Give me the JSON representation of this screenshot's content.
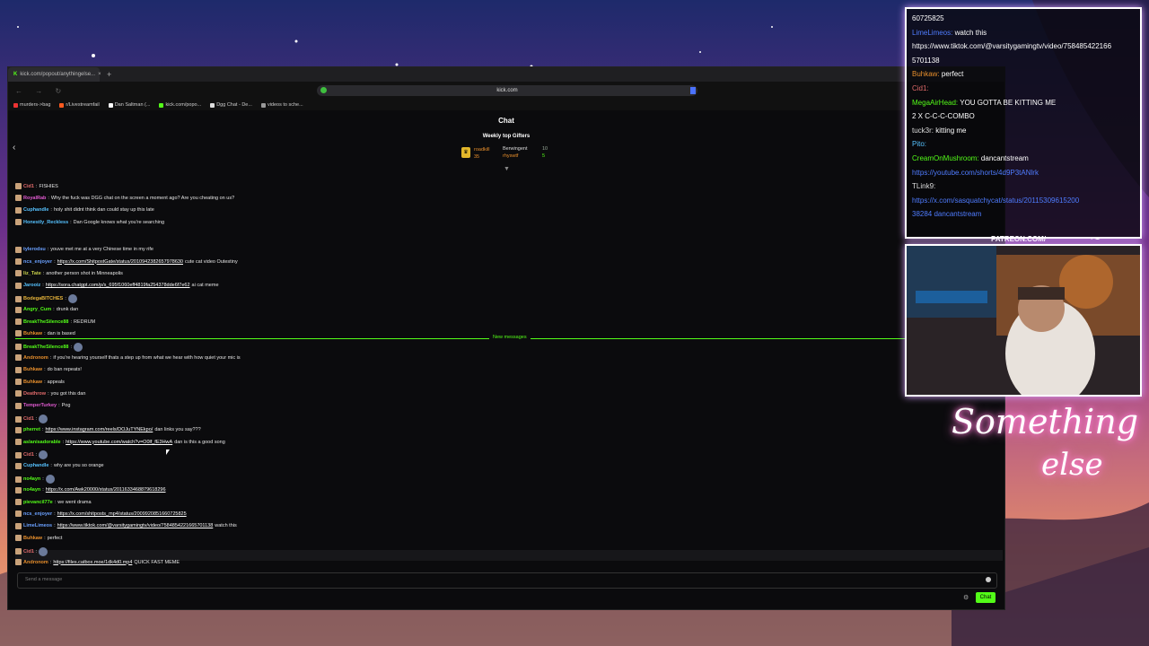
{
  "browser": {
    "tab_title": "kick.com/popout/anythingelse...",
    "tab_close": "×",
    "new_tab": "+",
    "url": "kick.com",
    "bookmarks": [
      "murders->bag",
      "r/Livestreamfail",
      "Dan Saltman (...",
      "kick.com/popo...",
      "Dgg Chat - De...",
      "videos to sche..."
    ]
  },
  "chat": {
    "title": "Chat",
    "back": "‹",
    "gifters_title": "Weekly top Gifters",
    "gifters": [
      {
        "name": "roadkill",
        "count": "35"
      },
      {
        "name": "Berwingent",
        "count": "10"
      },
      {
        "name": "rhyswtf",
        "count": "5"
      }
    ],
    "new_messages_label": "New messages",
    "input_placeholder": "Send a message",
    "send_label": "Chat",
    "messages": [
      {
        "user": "Cid1",
        "color": "#e06a6a",
        "text": "FISHIES",
        "link": ""
      },
      {
        "user": "RoyalRab",
        "color": "#e05ad0",
        "text": "Why the fuck was DGG chat on the screen a moment ago? Are you cheating on us?",
        "link": ""
      },
      {
        "user": "Cuphandle",
        "color": "#56c2ff",
        "text": "holy shit didnt think dan could stay up this late",
        "link": ""
      },
      {
        "user": "Honestly_Reckless",
        "color": "#56c2ff",
        "text": "Dan Google knows what you're searching",
        "link": ""
      },
      {
        "user": "tylerodsu",
        "color": "#6aa0ff",
        "text": "youve met me at a very Chinese time in my rife",
        "link": ""
      },
      {
        "user": "ncs_enjoyer",
        "color": "#6aa0ff",
        "text": "cute cat video Outestiny",
        "link": "https://x.com/ShitpostGate/status/2010942382657978630"
      },
      {
        "user": "liz_Tate",
        "color": "#c8d04a",
        "text": "another person shot in Minneapolis",
        "link": ""
      },
      {
        "user": "Jarooiz",
        "color": "#56c2ff",
        "text": "ai cat meme",
        "link": "https://sora.chatgpt.com/p/s_695f1060eff4819fa254378dde6f7e62"
      },
      {
        "user": "BodegaBITCHES",
        "color": "#e8b53a",
        "text": "",
        "link": ""
      },
      {
        "user": "Angry_Cum",
        "color": "#53fc18",
        "text": "drunk dan",
        "link": ""
      },
      {
        "user": "BreakTheSilence88",
        "color": "#53fc18",
        "text": "REDRUM",
        "link": ""
      },
      {
        "user": "Buhkaw",
        "color": "#e88f2c",
        "text": "dan is based",
        "link": ""
      },
      {
        "user": "BreakTheSilence88",
        "color": "#53fc18",
        "text": "",
        "link": ""
      },
      {
        "user": "Andronom",
        "color": "#e88f2c",
        "text": "if you're hearing yourself thats a step up from what we hear with how quiet your mic is",
        "link": ""
      },
      {
        "user": "Buhkaw",
        "color": "#e88f2c",
        "text": "do ban repeats!",
        "link": ""
      },
      {
        "user": "Buhkaw",
        "color": "#e88f2c",
        "text": "appeals",
        "link": ""
      },
      {
        "user": "Deathrow",
        "color": "#e06a6a",
        "text": "you got this dan",
        "link": ""
      },
      {
        "user": "TemperTurkey",
        "color": "#e05ad0",
        "text": "Pog",
        "link": ""
      },
      {
        "user": "Cid1",
        "color": "#e06a6a",
        "text": "",
        "link": ""
      },
      {
        "user": "pherret",
        "color": "#53fc18",
        "text": "dan links you say???",
        "link": "https://www.instagram.com/reels/DOJuTYNEkpo/"
      },
      {
        "user": "aslanisadorable",
        "color": "#53fc18",
        "text": "dan is this a good song",
        "link": "https://www.youtube.com/watch?v=O0lf_fE3HwA"
      },
      {
        "user": "Cid1",
        "color": "#e06a6a",
        "text": "",
        "link": ""
      },
      {
        "user": "Cuphandle",
        "color": "#56c2ff",
        "text": "why are you so orange",
        "link": ""
      },
      {
        "user": "no4ayn",
        "color": "#53fc18",
        "text": "",
        "link": ""
      },
      {
        "user": "no4ayn",
        "color": "#53fc18",
        "text": "",
        "link": "https://x.com/Awk20000/status/2011633468879618296"
      },
      {
        "user": "pievancil77e",
        "color": "#53fc18",
        "text": "we went drama",
        "link": ""
      },
      {
        "user": "ncs_enjoyer",
        "color": "#6aa0ff",
        "text": "",
        "link": "https://x.com/shitposts_mp4/status/2009920851660725825"
      },
      {
        "user": "LimeLimeos",
        "color": "#6aa0ff",
        "text": "watch this",
        "link": "https://www.tiktok.com/@varsitygamingtv/video/7584854221665701138"
      },
      {
        "user": "Buhkaw",
        "color": "#e88f2c",
        "text": "perfect",
        "link": ""
      },
      {
        "user": "Cid1",
        "color": "#e06a6a",
        "text": "",
        "link": ""
      },
      {
        "user": "Andronom",
        "color": "#e88f2c",
        "text": "QUICK FAST MEME",
        "link": "https://files.catbox.moe/1dk4d0.mp4"
      }
    ]
  },
  "overlay": {
    "lines": [
      {
        "user": "",
        "color": "#fff",
        "text": "60725825"
      },
      {
        "user": "LimeLimeos",
        "color": "#4f7cff",
        "text": "watch this"
      },
      {
        "user": "",
        "color": "#fff",
        "text": "https://www.tiktok.com/@varsitygamingtv/video/758485422166"
      },
      {
        "user": "",
        "color": "#fff",
        "text": "5701138"
      },
      {
        "user": "Buhkaw",
        "color": "#e88f2c",
        "text": "perfect"
      },
      {
        "user": "Cid1",
        "color": "#e06a6a",
        "text": ""
      },
      {
        "user": "MegaAirHead",
        "color": "#53fc18",
        "text": "YOU GOTTA BE KITTING ME"
      },
      {
        "user": "",
        "color": "#fff",
        "text": "2 X C-C-C-COMBO"
      },
      {
        "user": "tuck3r",
        "color": "#ddd",
        "text": "kitting me"
      },
      {
        "user": "Pito",
        "color": "#56c2ff",
        "text": ""
      },
      {
        "user": "CreamOnMushroom",
        "color": "#53fc18",
        "text": "dancantstream"
      },
      {
        "user": "",
        "color": "#4f7cff",
        "text": "https://youtube.com/shorts/4d9P3tANlrk"
      },
      {
        "user": "TLink9",
        "color": "#ddd",
        "text": ""
      },
      {
        "user": "",
        "color": "#4f7cff",
        "text": "https://x.com/sasquatchycat/status/20115309615200"
      },
      {
        "user": "",
        "color": "#4f7cff",
        "text": "38284 dancantstream"
      }
    ],
    "patreon": "PATREON.COM/",
    "brand_signature": "Anything else",
    "neon_line1": "Something",
    "neon_line2": "else"
  }
}
